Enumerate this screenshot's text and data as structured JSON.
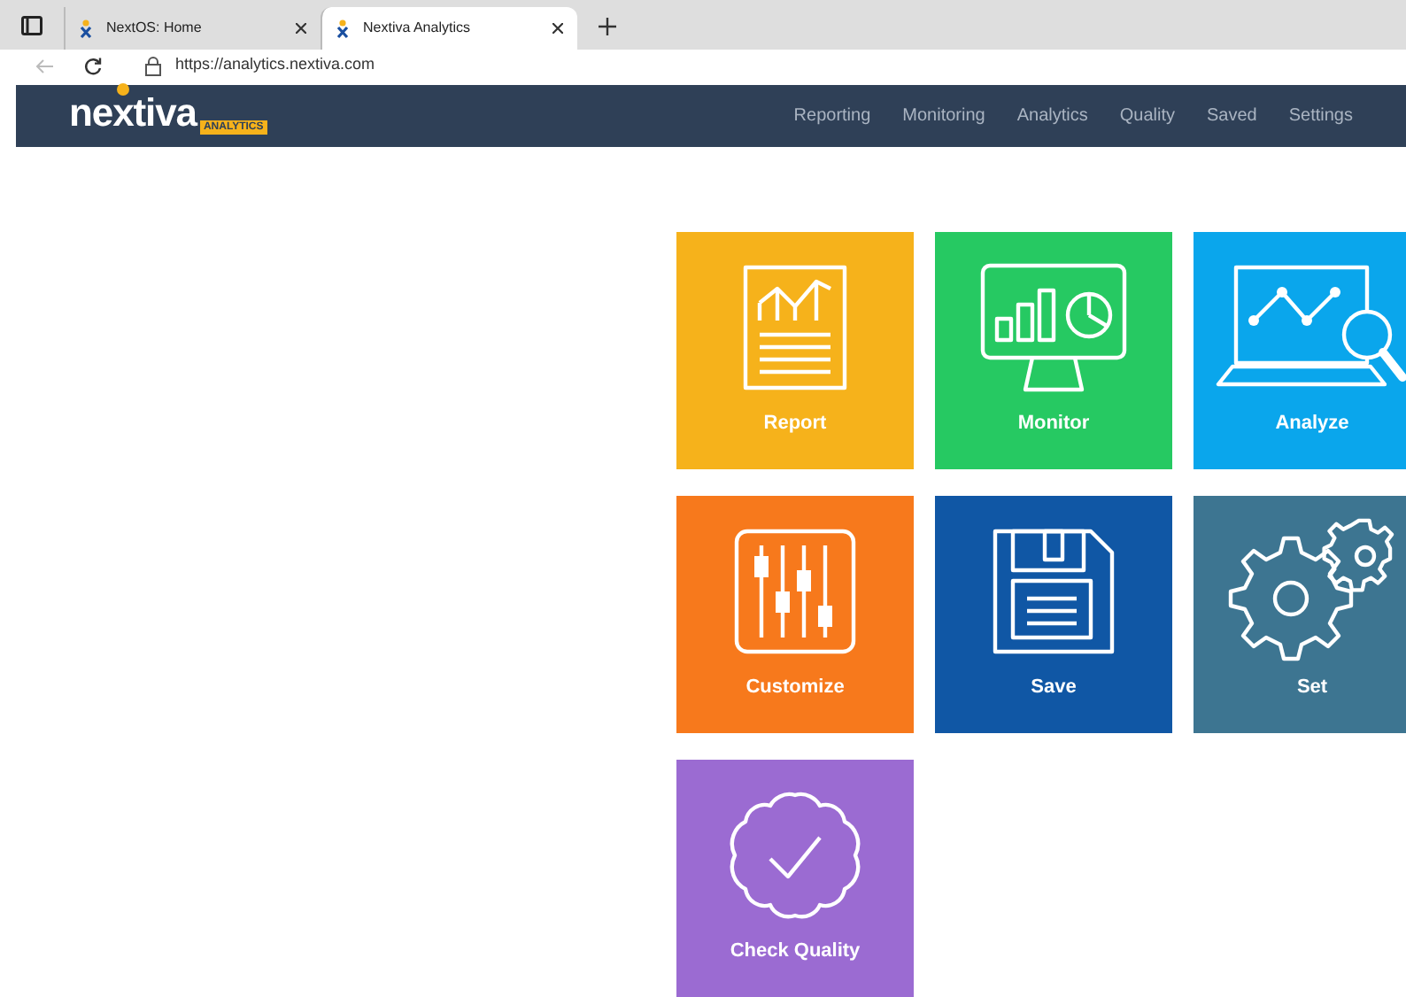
{
  "browser": {
    "tabs": [
      {
        "label": "NextOS: Home",
        "selected": false
      },
      {
        "label": "Nextiva Analytics",
        "selected": true
      }
    ],
    "url": "https://analytics.nextiva.com"
  },
  "header": {
    "logo": "nextiva",
    "badge": "ANALYTICS",
    "nav": [
      "Reporting",
      "Monitoring",
      "Analytics",
      "Quality",
      "Saved",
      "Settings"
    ]
  },
  "tiles": [
    {
      "label": "Report",
      "kind": "report",
      "color": "#f6b21b"
    },
    {
      "label": "Monitor",
      "kind": "monitor",
      "color": "#26c962"
    },
    {
      "label": "Analyze",
      "kind": "analyze",
      "color": "#0aa6ec"
    },
    {
      "label": "Customize",
      "kind": "customize",
      "color": "#f7791c"
    },
    {
      "label": "Save",
      "kind": "save",
      "color": "#1057a5"
    },
    {
      "label": "Set",
      "kind": "set",
      "color": "#3d7591"
    },
    {
      "label": "Check Quality",
      "kind": "quality",
      "color": "#9b6bd2"
    }
  ]
}
